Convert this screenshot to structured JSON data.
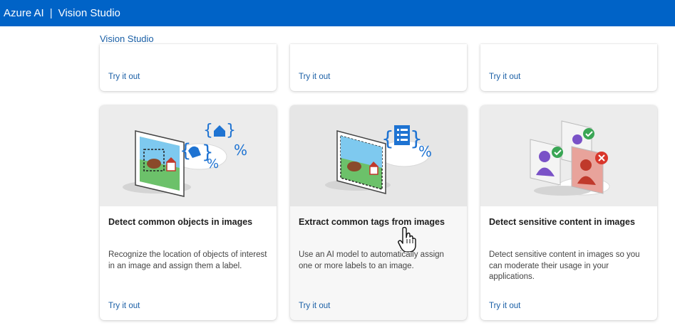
{
  "topbar": {
    "brand": "Azure AI",
    "separator": "|",
    "product": "Vision Studio"
  },
  "breadcrumb": "Vision Studio",
  "top_cards": [
    {
      "try_label": "Try it out"
    },
    {
      "try_label": "Try it out"
    },
    {
      "try_label": "Try it out"
    }
  ],
  "cards": [
    {
      "title": "Detect common objects in images",
      "description": "Recognize the location of objects of interest in an image and assign them a label.",
      "try_label": "Try it out",
      "illustration_icon": "object-detection-illustration"
    },
    {
      "title": "Extract common tags from images",
      "description": "Use an AI model to automatically assign one or more labels to an image.",
      "try_label": "Try it out",
      "illustration_icon": "image-tagging-illustration"
    },
    {
      "title": "Detect sensitive content in images",
      "description": "Detect sensitive content in images so you can moderate their usage in your applications.",
      "try_label": "Try it out",
      "illustration_icon": "content-moderation-illustration"
    }
  ],
  "colors": {
    "topbar": "#0063c7",
    "link": "#1a5fa6",
    "accent_blue": "#1e73d2"
  },
  "cursor_icon": "hand-pointer-icon"
}
